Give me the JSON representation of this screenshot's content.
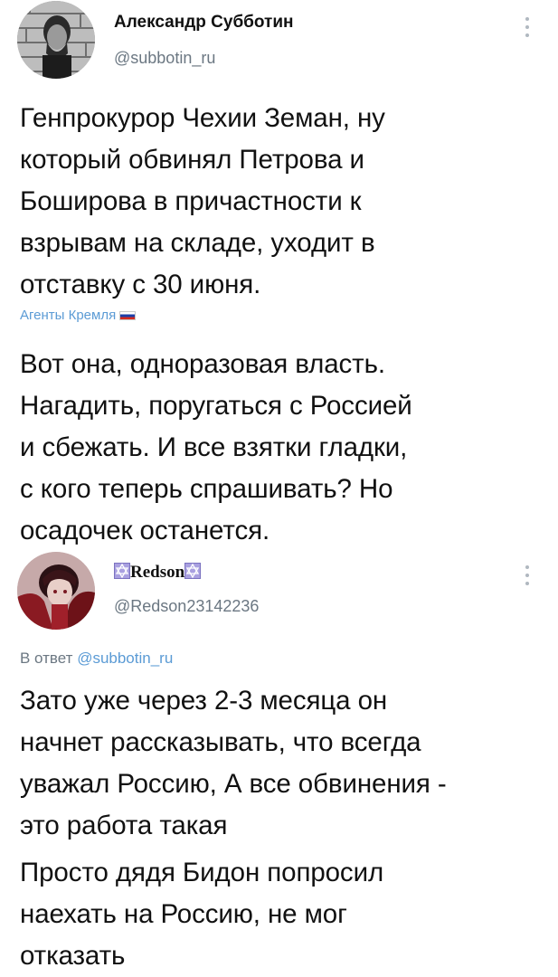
{
  "tweet1": {
    "author_name": "Александр Субботин",
    "author_handle": "@subbotin_ru",
    "body_lines": [
      "Генпрокурор Чехии Земан, ну",
      "который обвинял Петрова и",
      "Боширова в причастности к",
      "взрывам на складе, уходит в",
      "отставку с 30 июня."
    ],
    "channel_label": "Агенты Кремля",
    "channel_flag_icon": "russia-flag-icon",
    "comment_lines": [
      "Вот она, одноразовая власть.",
      "Нагадить, поругаться с Россией",
      "и сбежать. И все взятки гладки,",
      "с кого теперь спрашивать? Но",
      "осадочек останется."
    ]
  },
  "tweet2": {
    "author_name": "Redson",
    "author_decoration_icon": "star-of-david-icon",
    "author_handle": "@Redson23142236",
    "reply_prefix": "В ответ",
    "reply_handle": "@subbotin_ru",
    "body_lines": [
      "Зато уже через 2-3 месяца он",
      "начнет рассказывать, что всегда",
      "уважал Россию, А все обвинения -",
      "это работа такая"
    ],
    "body2_lines": [
      "Просто дядя Бидон попросил",
      "наехать на Россию, не мог",
      "отказать"
    ]
  },
  "colors": {
    "link": "#5b9bd5",
    "secondary_text": "#6b7782",
    "primary_text": "#111111",
    "background": "#ffffff"
  }
}
